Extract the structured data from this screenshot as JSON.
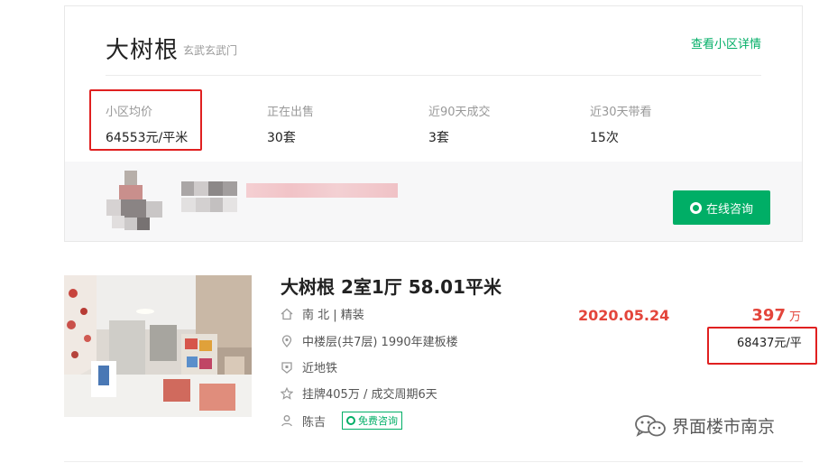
{
  "community": {
    "name": "大树根",
    "district": "玄武玄武门",
    "detail_link": "查看小区详情",
    "stats": [
      {
        "label": "小区均价",
        "value": "64553元/平米"
      },
      {
        "label": "正在出售",
        "value": "30套"
      },
      {
        "label": "近90天成交",
        "value": "3套"
      },
      {
        "label": "近30天带看",
        "value": "15次"
      }
    ],
    "consult_button": "在线咨询"
  },
  "listing": {
    "title": "大树根 2室1厅 58.01平米",
    "orientation": "南 北 | 精装",
    "floor_info": "中楼层(共7层) 1990年建板楼",
    "subway": "近地铁",
    "listing_info": "挂牌405万 / 成交周期6天",
    "agent": "陈吉",
    "free_consult": "免费咨询",
    "deal_date": "2020.05.24",
    "deal_price": "397",
    "deal_price_unit": "万",
    "unit_price": "68437元/平"
  },
  "watermark": "界面楼市南京",
  "colors": {
    "accent_green": "#00ae66",
    "price_red": "#e3453b",
    "highlight_red": "#e02020"
  },
  "icons": [
    "chat-icon",
    "home-icon",
    "location-icon",
    "subway-icon",
    "star-icon",
    "person-icon",
    "wechat-icon"
  ]
}
